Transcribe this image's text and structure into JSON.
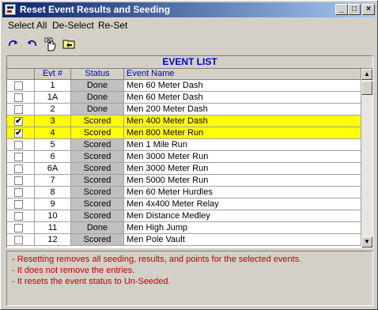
{
  "window": {
    "title": "Reset Event Results and Seeding",
    "minimize": "_",
    "maximize": "□",
    "close": "×"
  },
  "menu": {
    "items": [
      {
        "label": "Select All"
      },
      {
        "label": "De-Select"
      },
      {
        "label": "Re-Set"
      }
    ]
  },
  "toolbar": {
    "icons": [
      "redo-icon",
      "undo-icon",
      "reset-hand-icon",
      "exit-folder-icon"
    ]
  },
  "grid": {
    "title": "EVENT LIST",
    "columns": {
      "check": "",
      "evt": "Evt #",
      "status": "Status",
      "name": "Event Name"
    },
    "rows": [
      {
        "checked": false,
        "evt": "1",
        "status": "Done",
        "name": "Men 60 Meter Dash"
      },
      {
        "checked": false,
        "evt": "1A",
        "status": "Done",
        "name": "Men 60 Meter Dash"
      },
      {
        "checked": false,
        "evt": "2",
        "status": "Done",
        "name": "Men 200 Meter Dash"
      },
      {
        "checked": true,
        "evt": "3",
        "status": "Scored",
        "name": "Men 400 Meter Dash"
      },
      {
        "checked": true,
        "evt": "4",
        "status": "Scored",
        "name": "Men 800 Meter Run"
      },
      {
        "checked": false,
        "evt": "5",
        "status": "Scored",
        "name": "Men 1 Mile Run"
      },
      {
        "checked": false,
        "evt": "6",
        "status": "Scored",
        "name": "Men 3000 Meter Run"
      },
      {
        "checked": false,
        "evt": "6A",
        "status": "Scored",
        "name": "Men 3000 Meter Run"
      },
      {
        "checked": false,
        "evt": "7",
        "status": "Scored",
        "name": "Men 5000 Meter Run"
      },
      {
        "checked": false,
        "evt": "8",
        "status": "Scored",
        "name": "Men 60 Meter Hurdles"
      },
      {
        "checked": false,
        "evt": "9",
        "status": "Scored",
        "name": "Men 4x400 Meter Relay"
      },
      {
        "checked": false,
        "evt": "10",
        "status": "Scored",
        "name": "Men Distance Medley"
      },
      {
        "checked": false,
        "evt": "11",
        "status": "Done",
        "name": "Men High Jump"
      },
      {
        "checked": false,
        "evt": "12",
        "status": "Scored",
        "name": "Men Pole Vault"
      }
    ],
    "selected_color": "#ffff00",
    "status_color": "#c0c0c0"
  },
  "notes": {
    "lines": [
      "- Resetting removes all seeding, results, and points for the selected events.",
      "- It does not remove the entries.",
      "- It resets the event status to Un-Seeded."
    ],
    "color": "#c00000"
  }
}
